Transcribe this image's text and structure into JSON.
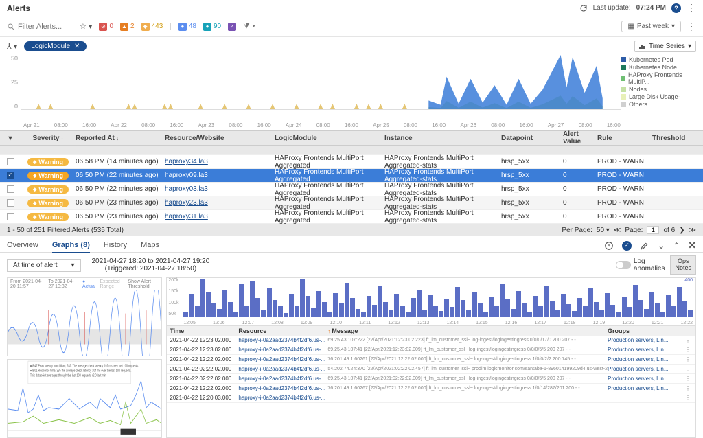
{
  "header": {
    "title": "Alerts",
    "last_update_label": "Last update:",
    "last_update_time": "07:24 PM"
  },
  "filter": {
    "search_placeholder": "Filter Alerts...",
    "severity_counts": {
      "critical": "0",
      "error": "2",
      "warning": "443",
      "blue": "48",
      "cyan": "90"
    },
    "date_range": "Past week"
  },
  "group": {
    "pill": "LogicModule",
    "mode": "Time Series"
  },
  "chart_data": {
    "type": "area",
    "ylim": [
      0,
      50
    ],
    "yticks": [
      "50",
      "25",
      "0"
    ],
    "xlabels": [
      "Apr 21",
      "08:00",
      "16:00",
      "Apr 22",
      "08:00",
      "16:00",
      "Apr 23",
      "08:00",
      "16:00",
      "Apr 24",
      "08:00",
      "16:00",
      "Apr 25",
      "08:00",
      "16:00",
      "Apr 26",
      "08:00",
      "16:00",
      "Apr 27",
      "08:00",
      "16:00"
    ],
    "legend": [
      {
        "label": "Kubernetes Pod",
        "color": "#2e5da8"
      },
      {
        "label": "Kubernetes Node",
        "color": "#1f7a5c"
      },
      {
        "label": "HAProxy Frontends MultiP...",
        "color": "#6fbf73"
      },
      {
        "label": "Nodes",
        "color": "#c5e1a5"
      },
      {
        "label": "Large Disk Usage-",
        "color": "#e8f0b8"
      },
      {
        "label": "Others",
        "color": "#d0d0d0"
      }
    ],
    "small_spikes_x": [
      0.03,
      0.05,
      0.12,
      0.18,
      0.19,
      0.24,
      0.25,
      0.3,
      0.34,
      0.38,
      0.42,
      0.46,
      0.5,
      0.52,
      0.56,
      0.58,
      0.6,
      0.64
    ],
    "large_blue_points": [
      [
        0.68,
        8
      ],
      [
        0.7,
        4
      ],
      [
        0.71,
        30
      ],
      [
        0.73,
        5
      ],
      [
        0.75,
        28
      ],
      [
        0.77,
        6
      ],
      [
        0.79,
        22
      ],
      [
        0.81,
        4
      ],
      [
        0.83,
        28
      ],
      [
        0.85,
        5
      ],
      [
        0.87,
        18
      ],
      [
        0.9,
        50
      ],
      [
        0.91,
        20
      ],
      [
        0.92,
        48
      ],
      [
        0.94,
        15
      ],
      [
        0.96,
        40
      ],
      [
        0.97,
        10
      ]
    ]
  },
  "table": {
    "columns": {
      "severity": "Severity",
      "reported": "Reported At",
      "resource": "Resource/Website",
      "logic": "LogicModule",
      "instance": "Instance",
      "datapoint": "Datapoint",
      "alert_value": "Alert Value",
      "rule": "Rule",
      "threshold": "Threshold"
    },
    "rows": [
      {
        "sev": "Warning",
        "reported": "06:58 PM (14 minutes ago)",
        "resource": "haproxy34.la3",
        "logic": "HAProxy Frontends MultiPort Aggregated",
        "instance": "HAProxy Frontends MultiPort Aggregated-stats",
        "dp": "hrsp_5xx",
        "av": "0",
        "rule": "PROD - WARN",
        "thr": "",
        "selected": false,
        "stripe": false
      },
      {
        "sev": "Warning",
        "reported": "06:50 PM (22 minutes ago)",
        "resource": "haproxy09.la3",
        "logic": "HAProxy Frontends MultiPort Aggregated",
        "instance": "HAProxy Frontends MultiPort Aggregated-stats",
        "dp": "hrsp_5xx",
        "av": "0",
        "rule": "PROD - WARN",
        "thr": "",
        "selected": true,
        "stripe": false
      },
      {
        "sev": "Warning",
        "reported": "06:50 PM (22 minutes ago)",
        "resource": "haproxy03.la3",
        "logic": "HAProxy Frontends MultiPort Aggregated",
        "instance": "HAProxy Frontends MultiPort Aggregated-stats",
        "dp": "hrsp_5xx",
        "av": "0",
        "rule": "PROD - WARN",
        "thr": "",
        "selected": false,
        "stripe": false
      },
      {
        "sev": "Warning",
        "reported": "06:50 PM (23 minutes ago)",
        "resource": "haproxy23.la3",
        "logic": "HAProxy Frontends MultiPort Aggregated",
        "instance": "HAProxy Frontends MultiPort Aggregated-stats",
        "dp": "hrsp_5xx",
        "av": "0",
        "rule": "PROD - WARN",
        "thr": "",
        "selected": false,
        "stripe": true
      },
      {
        "sev": "Warning",
        "reported": "06:50 PM (23 minutes ago)",
        "resource": "haproxy31.la3",
        "logic": "HAProxy Frontends MultiPort Aggregated",
        "instance": "HAProxy Frontends MultiPort Aggregated-stats",
        "dp": "hrsp_5xx",
        "av": "0",
        "rule": "PROD - WARN",
        "thr": "",
        "selected": false,
        "stripe": false
      }
    ]
  },
  "pagination": {
    "summary": "1 - 50 of 251 Filtered Alerts (535 Total)",
    "per_page_label": "Per Page:",
    "per_page": "50",
    "page_label": "Page:",
    "page": "1",
    "of": "of 6"
  },
  "tabs": {
    "items": [
      "Overview",
      "Graphs (8)",
      "History",
      "Maps"
    ],
    "active": 1,
    "right_labels": {
      "log_anom": "Log\nanomalies",
      "ops": "Ops\nNotes"
    }
  },
  "time_sel": {
    "dropdown": "At time of alert",
    "range": "2021-04-27 18:20 to 2021-04-27 19:20",
    "triggered": "(Triggered: 2021-04-27 18:50)"
  },
  "log_chart": {
    "yticks": [
      "200k",
      "150k",
      "100k",
      "50k"
    ],
    "right_ytick": "400",
    "xticks": [
      "12:05",
      "12:06",
      "12:07",
      "12:08",
      "12:09",
      "12:10",
      "12:11",
      "12:12",
      "12:13",
      "12:14",
      "12:15",
      "12:16",
      "12:17",
      "12:18",
      "12:19",
      "12:20",
      "12:21",
      "12:22"
    ],
    "bars": [
      12,
      60,
      30,
      100,
      65,
      35,
      22,
      70,
      40,
      15,
      85,
      30,
      95,
      50,
      20,
      75,
      45,
      28,
      10,
      60,
      30,
      98,
      55,
      25,
      68,
      40,
      12,
      62,
      35,
      90,
      50,
      22,
      15,
      55,
      32,
      82,
      40,
      18,
      60,
      30,
      14,
      50,
      72,
      20,
      58,
      30,
      16,
      48,
      26,
      78,
      45,
      20,
      64,
      36,
      12,
      52,
      28,
      88,
      46,
      22,
      68,
      38,
      14,
      56,
      30,
      80,
      42,
      20,
      60,
      34,
      16,
      50,
      28,
      76,
      40,
      18,
      62,
      32,
      12,
      54,
      26,
      84,
      44,
      22,
      66,
      36,
      15,
      58,
      30,
      78,
      42,
      20
    ]
  },
  "log_table": {
    "columns": {
      "time": "Time",
      "resource": "Resource",
      "message": "Message",
      "groups": "Groups"
    },
    "rows": [
      {
        "time": "2021-04-22 12:23:02.000",
        "res": "haproxy-i-0a2aad2374b4f2df6.us-...",
        "msg": "69.25.43.107:222 [22/Apr/2021:12:23:02.223] ft_lm_customer_ssl~ log-ingest/logingestingress 0/0/0/17/0 200 207 - -",
        "grp": "Production servers, Lin..."
      },
      {
        "time": "2021-04-22 12:23:02.000",
        "res": "haproxy-i-0a2aad2374b4f2df6.us-...",
        "msg": "69.25.43.107:41 [22/Apr/2021:12:23:02.009] ft_lm_customer_ssl~ log-ingest/logingestingress 0/0/0/5/5 200 207 - -",
        "grp": "Production servers, Lin..."
      },
      {
        "time": "2021-04-22 12:22:02.000",
        "res": "haproxy-i-0a2aad2374b4f2df6.us-...",
        "msg": "76.201.49.1:60261 [22/Apr/2021:12:22:02.000] ft_lm_customer_ssl~ log-ingest/logingestingress 1/0/0/2/2 200 745 - -",
        "grp": "Production servers, Lin..."
      },
      {
        "time": "2021-04-22 02:22:02.000",
        "res": "haproxy-i-0a2aad2374b4f2df6.us-...",
        "msg": "54.202.74.24:370 [22/Apr/2021:02:22:02.457] ft_lm_customer_ssl~ prodlm.logicmonitor.com/santaba-1-896014199209d4.us-west-2 ",
        "grp": "Production servers, Lin..."
      },
      {
        "time": "2021-04-22 02:22:02.000",
        "res": "haproxy-i-0a2aad2374b4f2df6.us-...",
        "msg": "69.25.43.107:41 [22/Apr/2021:02:22:02.009] ft_lm_customer_ssl~ log-ingest/logingestingress 0/0/0/5/5 200 207 - -",
        "grp": "Production servers, Lin..."
      },
      {
        "time": "2021-04-22 12:22:02.000",
        "res": "haproxy-i-0a2aad2374b4f2df6.us-...",
        "msg": "76.201.49.1:60267 [22/Apr/2021:12:22:02.000] ft_lm_customer_ssl~ log-ingest/logingestingress 1/0/14/287/201 200 - -",
        "grp": "Production servers, Lin..."
      },
      {
        "time": "2021-04-22 12:20:03.000",
        "res": "haproxy-i-0a2aad2374b4f2df6.us-...",
        "msg": "",
        "grp": ""
      }
    ]
  }
}
